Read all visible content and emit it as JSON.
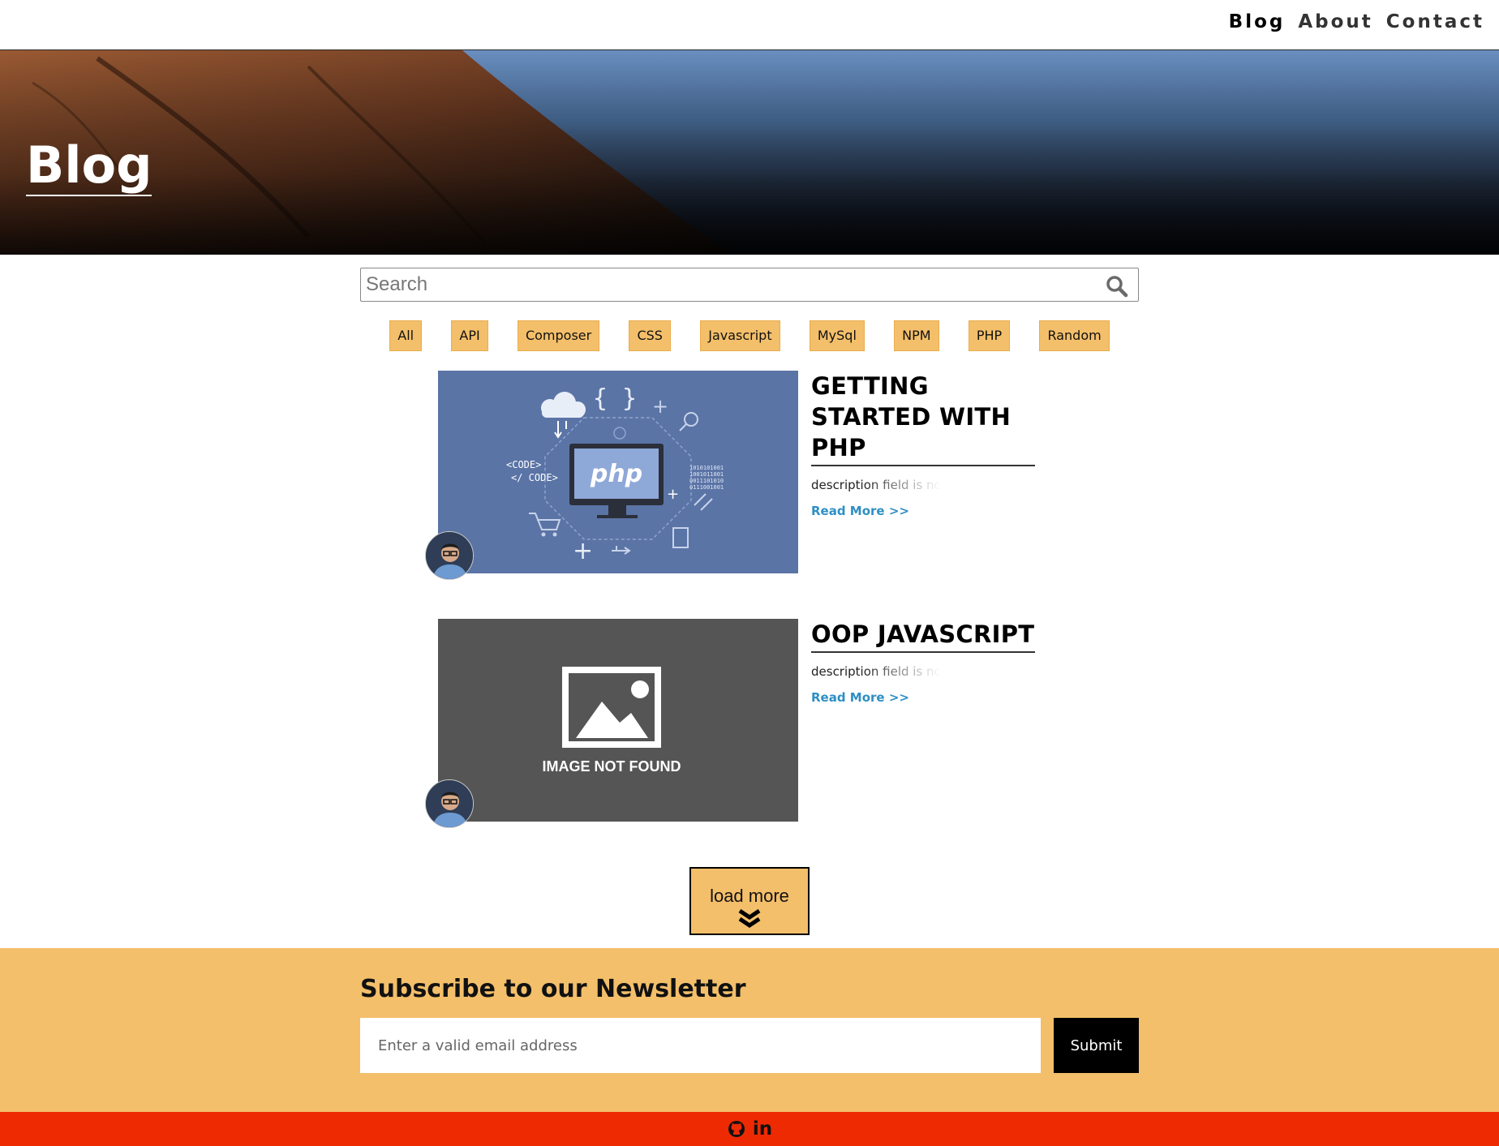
{
  "nav": {
    "links": [
      "Blog",
      "About",
      "Contact"
    ]
  },
  "hero": {
    "title": "Blog"
  },
  "search": {
    "placeholder": "Search"
  },
  "categories": [
    "All",
    "API",
    "Composer",
    "CSS",
    "Javascript",
    "MySql",
    "NPM",
    "PHP",
    "Random"
  ],
  "posts": [
    {
      "title": "GETTING STARTED WITH PHP",
      "description": "description field is no",
      "read_more": "Read More >>",
      "thumb_text": [
        "php",
        "<CODE>",
        "</ CODE>",
        "1010101001",
        "1001011001",
        "0011101010",
        "0111001001"
      ]
    },
    {
      "title": "OOP JAVASCRIPT",
      "description": "description field is no",
      "read_more": "Read More >>",
      "thumb_text": [
        "IMAGE NOT FOUND"
      ]
    }
  ],
  "load_more": {
    "label": "load more"
  },
  "newsletter": {
    "heading": "Subscribe to our Newsletter",
    "email_placeholder": "Enter a valid email address",
    "submit_label": "Submit"
  },
  "footer": {
    "icons": [
      "github-icon",
      "linkedin-icon"
    ],
    "linkedin_text": "in"
  },
  "colors": {
    "accent": "#f4bf6a",
    "link": "#2e8fc4",
    "footer": "#ee2a02",
    "thumb_php": "#5b74a6",
    "thumb_missing": "#555555"
  }
}
